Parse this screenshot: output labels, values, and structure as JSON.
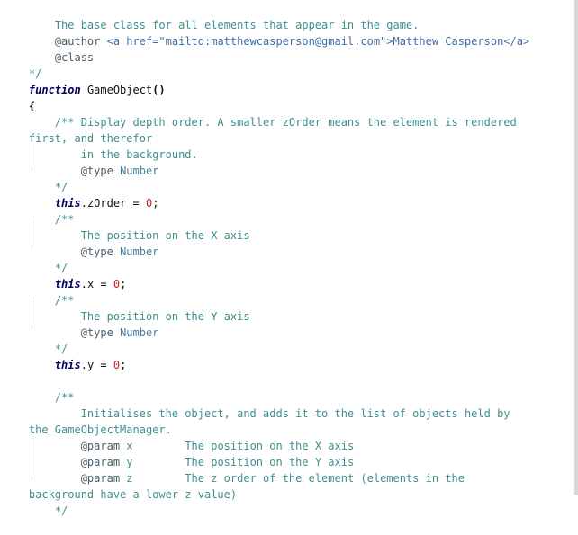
{
  "lines": [
    "    The base class for all elements that appear in the game.",
    "    @author <a href=\"mailto:matthewcasperson@gmail.com\">Matthew Casperson</a>",
    "    @class",
    "*/",
    "function GameObject()",
    "{",
    "    /** Display depth order. A smaller zOrder means the element is rendered",
    "first, and therefor",
    "        in the background.",
    "        @type Number",
    "    */",
    "    this.zOrder = 0;",
    "    /**",
    "        The position on the X axis",
    "        @type Number",
    "    */",
    "    this.x = 0;",
    "    /**",
    "        The position on the Y axis",
    "        @type Number",
    "    */",
    "    this.y = 0;",
    "",
    "    /**",
    "        Initialises the object, and adds it to the list of objects held by",
    "the GameObjectManager.",
    "        @param x        The position on the X axis",
    "        @param y        The position on the Y axis",
    "        @param z        The z order of the element (elements in the",
    "background have a lower z value)",
    "    */"
  ],
  "tokens": {
    "author_tag": "@author",
    "author_html": "<a href=\"mailto:matthewcasperson@gmail.com\">Matthew Casperson</a>",
    "class_tag": "@class",
    "close_comment": "*/",
    "open_comment": "/**",
    "function_kw": "function",
    "function_name": "GameObject",
    "function_parens": "()",
    "open_brace": "{",
    "type_tag": "@type",
    "type_number": "Number",
    "this_kw": "this",
    "zorder_prop": ".zOrder = ",
    "x_prop": ".x = ",
    "y_prop": ".y = ",
    "zero": "0",
    "semicolon": ";",
    "param_tag": "@param",
    "param_x": "x",
    "param_y": "y",
    "param_z": "z",
    "desc_top": "    The base class for all elements that appear in the game.",
    "desc_zorder_1": "    /** Display depth order. A smaller zOrder means the element is rendered",
    "desc_zorder_2": "first, and therefor",
    "desc_zorder_3": "in the background.",
    "desc_x_pos": "The position on the X axis",
    "desc_y_pos": "The position on the Y axis",
    "desc_init_1": "Initialises the object, and adds it to the list of objects held by",
    "desc_init_2": "the GameObjectManager.",
    "desc_param_x": "The position on the X axis",
    "desc_param_y": "The position on the Y axis",
    "desc_param_z": "The z order of the element (elements in the",
    "desc_param_z_2": "background have a lower z value)"
  },
  "colors": {
    "comment": "#3f8f8f",
    "keyword": "#000060",
    "number": "#c81e1e",
    "type": "#4a7fa0"
  }
}
